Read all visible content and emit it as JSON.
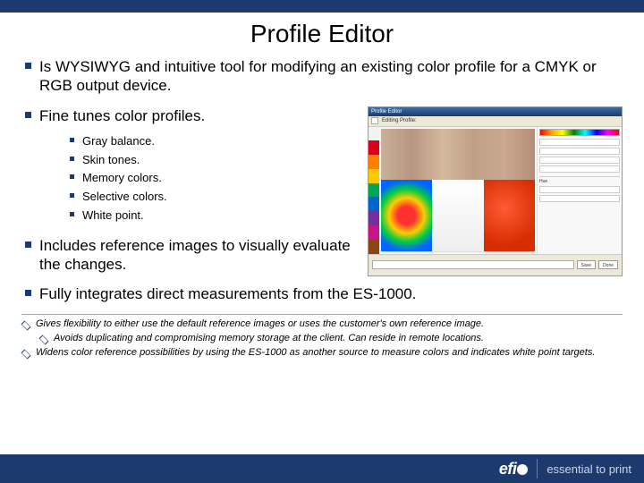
{
  "title": "Profile Editor",
  "bullets": {
    "b1": "Is WYSIWYG and intuitive tool for modifying an existing color profile for a CMYK or RGB output device.",
    "b2": "Fine tunes color profiles.",
    "b2_sub": {
      "s1": "Gray balance.",
      "s2": "Skin tones.",
      "s3": "Memory colors.",
      "s4": "Selective colors.",
      "s5": "White point."
    },
    "b3": "Includes reference images to visually evaluate the changes.",
    "b4": "Fully integrates direct measurements from the ES-1000."
  },
  "footnotes": {
    "f1": "Gives flexibility to either use the default reference images or uses the customer's own reference image.",
    "f1a": "Avoids duplicating and compromising memory storage at the client. Can reside in remote locations.",
    "f2": "Widens color reference possibilities by using the ES-1000 as another source to measure colors and indicates white point targets."
  },
  "screenshot": {
    "window_title": "Profile Editor",
    "toolbar_label": "Editing Profile:",
    "strip_colors": [
      "#f2f2f2",
      "#d9001b",
      "#ff7f00",
      "#ffc800",
      "#00a651",
      "#0066cc",
      "#7030a0",
      "#c71585",
      "#8b4513"
    ],
    "right_panel": {
      "header": "Hue"
    },
    "bottom": {
      "btn_save": "Save",
      "btn_done": "Done"
    }
  },
  "footer": {
    "logo_text": "efi",
    "tagline": "essential to print"
  }
}
